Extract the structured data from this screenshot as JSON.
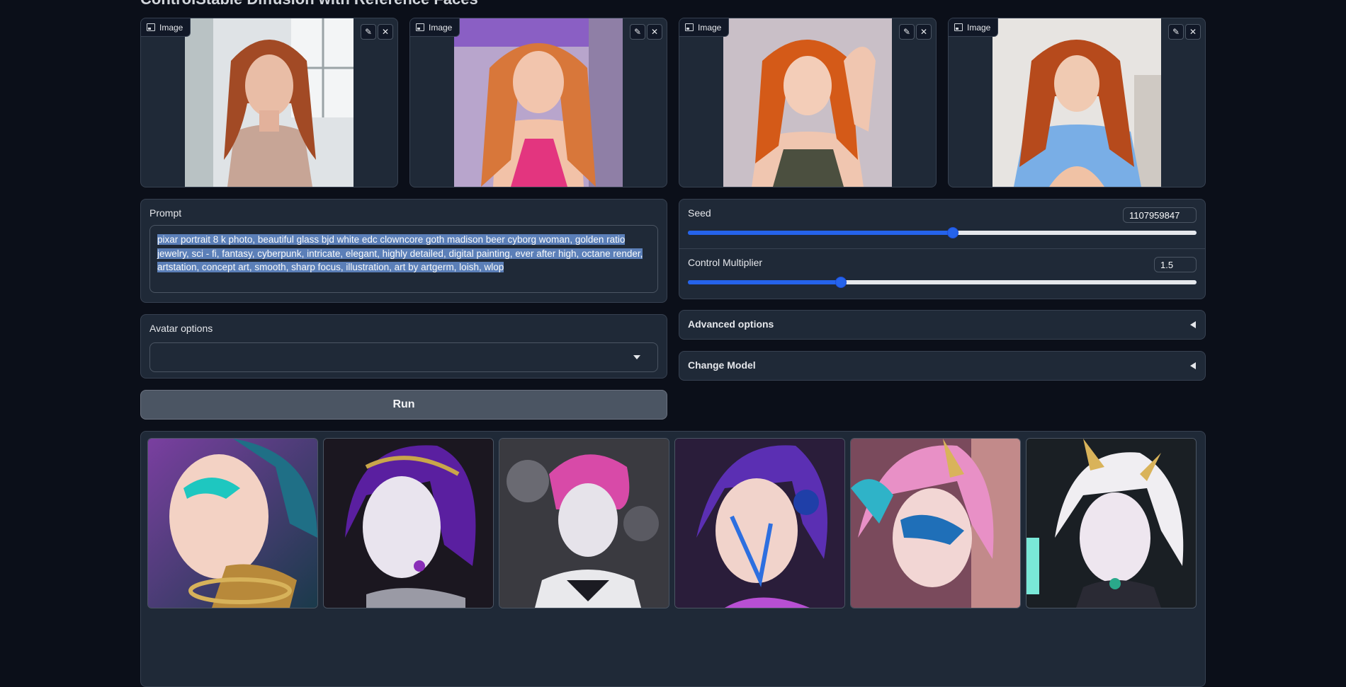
{
  "page": {
    "title": "ControlStable Diffusion with Reference Faces"
  },
  "reference_images": [
    {
      "label": "Image",
      "edit_icon": "pencil-icon",
      "close_icon": "close-icon"
    },
    {
      "label": "Image",
      "edit_icon": "pencil-icon",
      "close_icon": "close-icon"
    },
    {
      "label": "Image",
      "edit_icon": "pencil-icon",
      "close_icon": "close-icon"
    },
    {
      "label": "Image",
      "edit_icon": "pencil-icon",
      "close_icon": "close-icon"
    }
  ],
  "prompt": {
    "label": "Prompt",
    "value": "pixar portrait 8 k photo, beautiful glass bjd white edc clowncore goth madison beer cyborg woman, golden ratio jewelry, sci - fi, fantasy, cyberpunk, intricate, elegant, highly detailed, digital painting, ever after high, octane render, artstation, concept art, smooth, sharp focus, illustration, art by artgerm, loish, wlop"
  },
  "avatar_options": {
    "label": "Avatar options",
    "value": ""
  },
  "run_button": {
    "label": "Run"
  },
  "seed": {
    "label": "Seed",
    "value": "1107959847",
    "slider_fraction": 0.52
  },
  "control_multiplier": {
    "label": "Control Multiplier",
    "value": "1.5",
    "slider_fraction": 0.3
  },
  "advanced_options": {
    "label": "Advanced options"
  },
  "change_model": {
    "label": "Change Model"
  },
  "gallery": {
    "count": 6
  },
  "colors": {
    "accent": "#2563eb",
    "background": "#0b0f19",
    "panel": "#1f2937"
  }
}
